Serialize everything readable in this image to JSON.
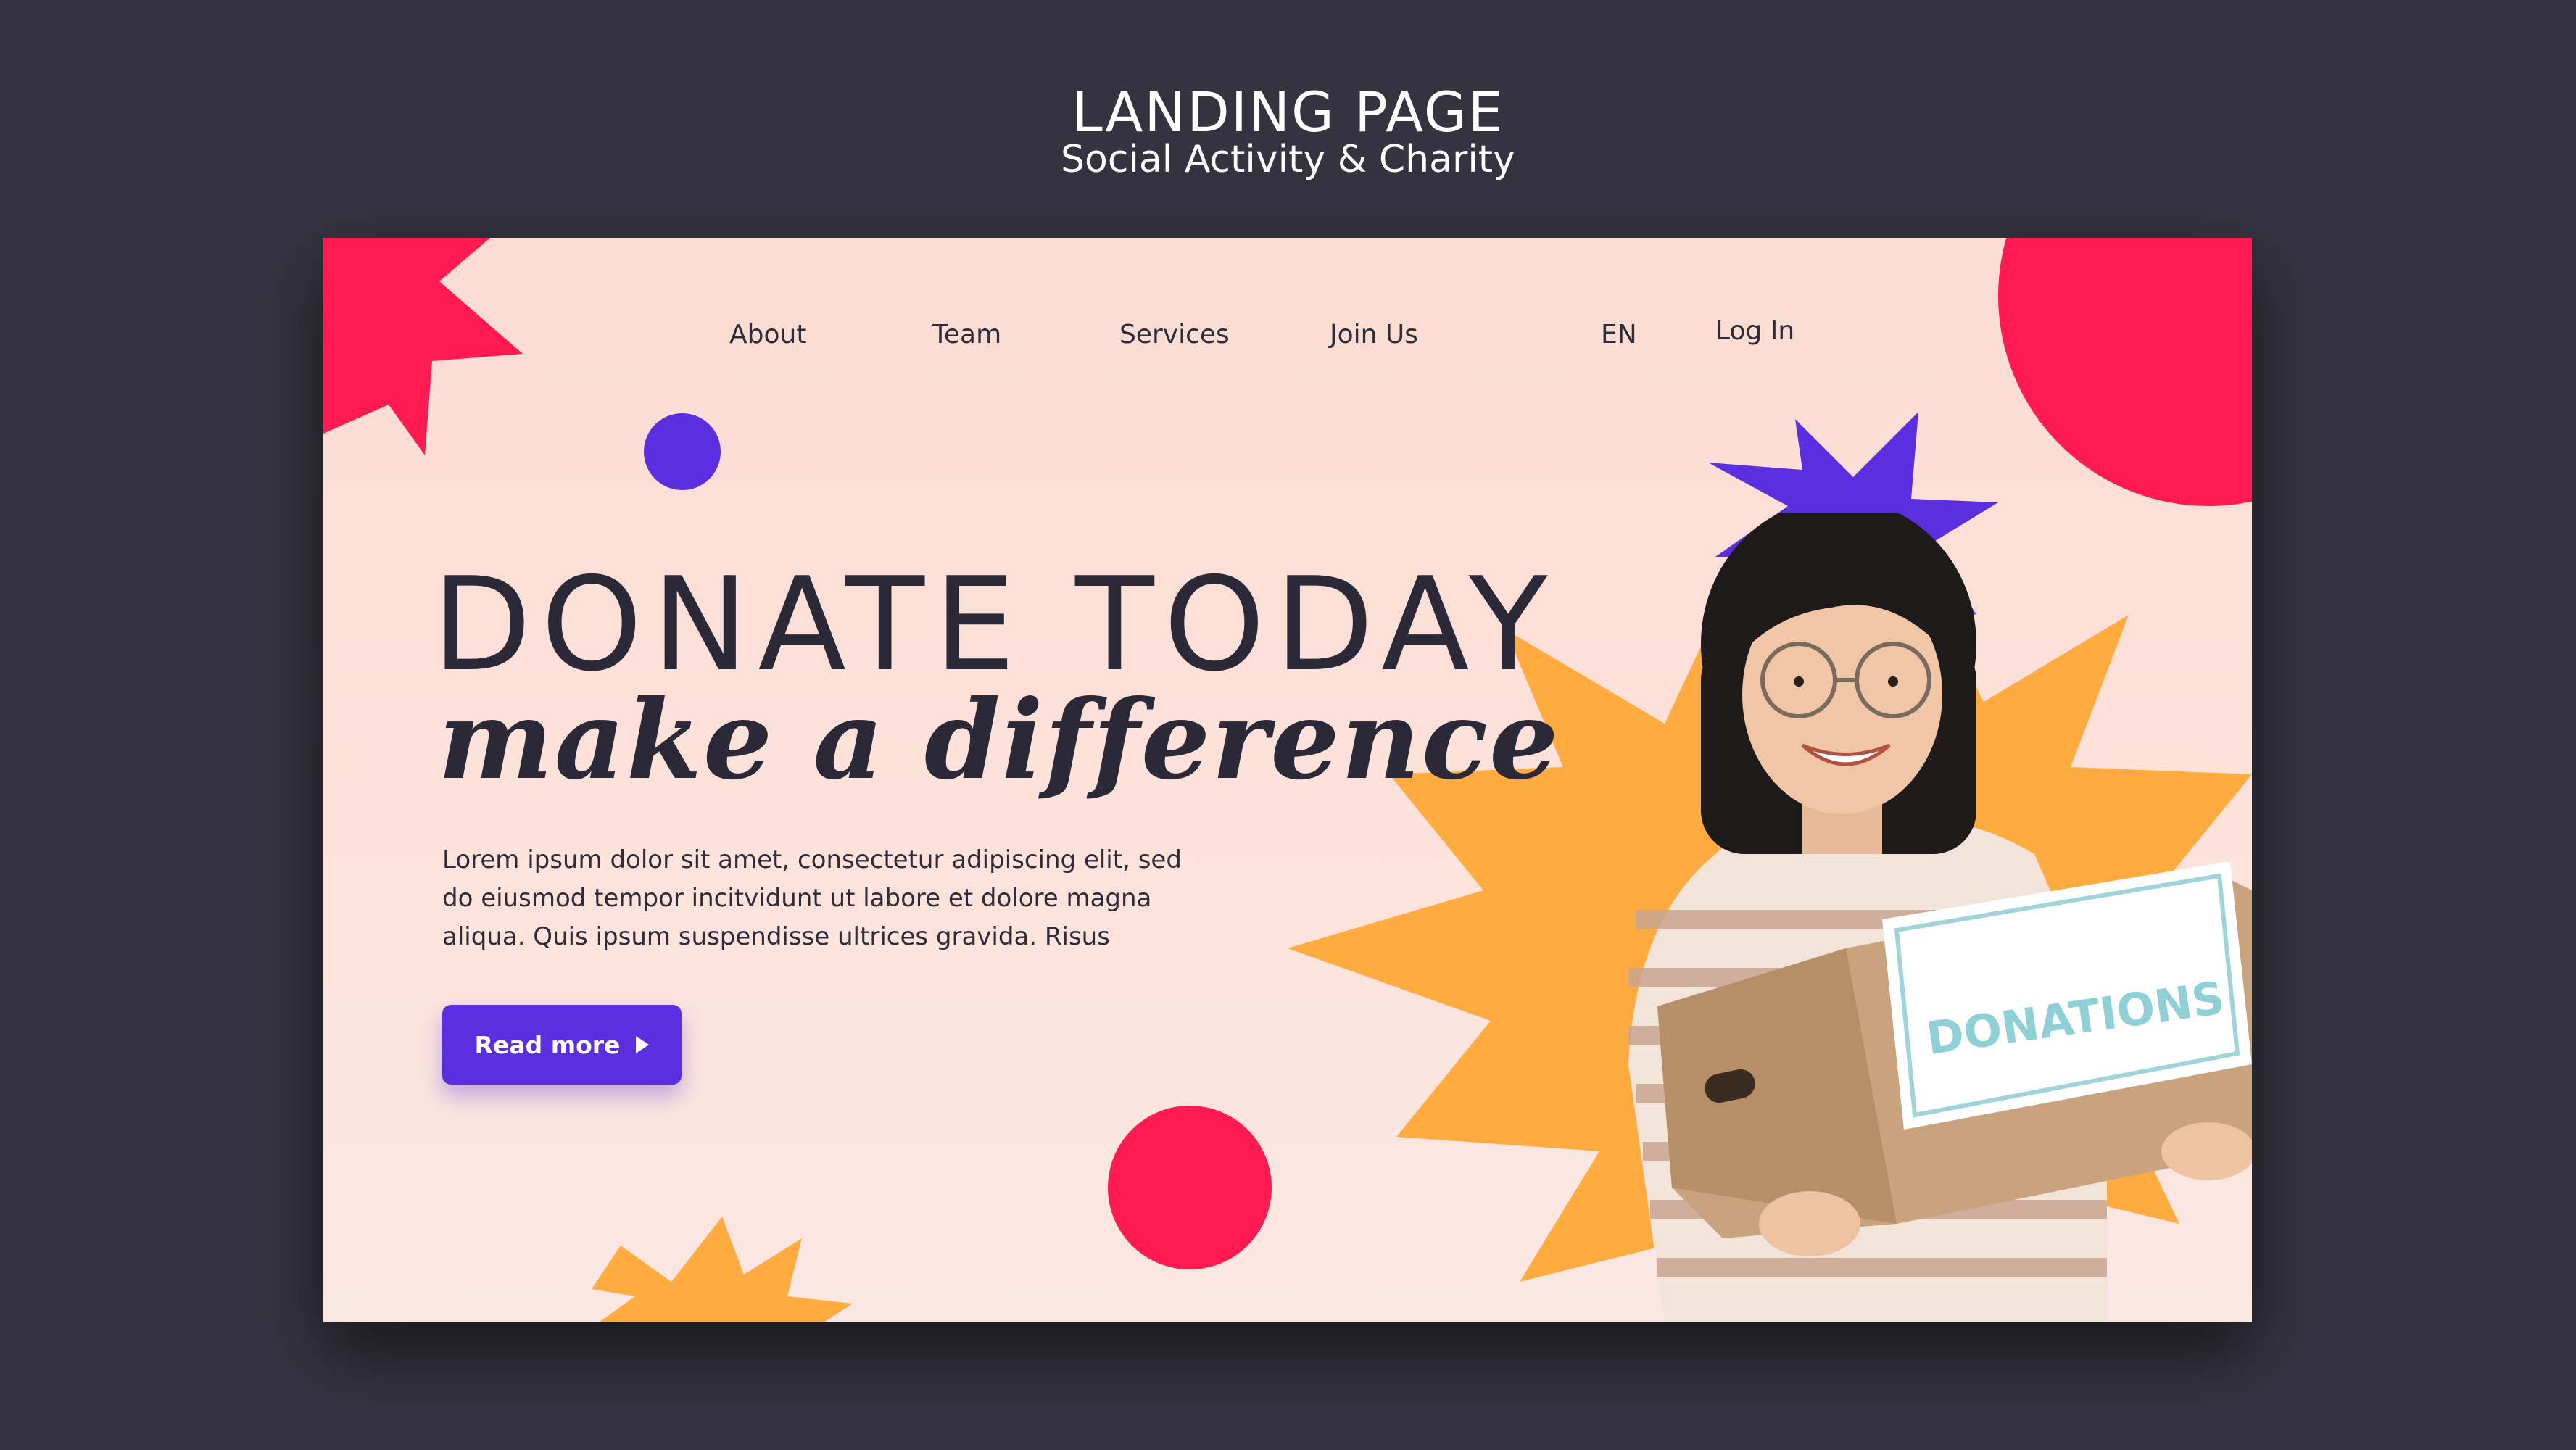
{
  "mockup": {
    "title": "LANDING PAGE",
    "subtitle": "Social Activity & Charity"
  },
  "nav": {
    "items": [
      "About",
      "Team",
      "Services",
      "Join Us"
    ],
    "language": "EN",
    "login": "Log In"
  },
  "hero": {
    "headline": "DONATE TODAY",
    "tagline": "make a difference",
    "body": "Lorem ipsum dolor sit amet, consectetur adipiscing elit, sed do eiusmod tempor incitvidunt ut labore et dolore magna aliqua. Quis ipsum suspendisse ultrices gravida. Risus",
    "cta_label": "Read more",
    "box_label": "DONATIONS"
  },
  "colors": {
    "background": "#34333f",
    "page": "#fde3dc",
    "accent_pink": "#ff1a50",
    "accent_purple": "#5b2ee0",
    "accent_orange": "#ffab40",
    "text": "#2b2838"
  },
  "icons": {
    "cta": "play-triangle-icon"
  }
}
